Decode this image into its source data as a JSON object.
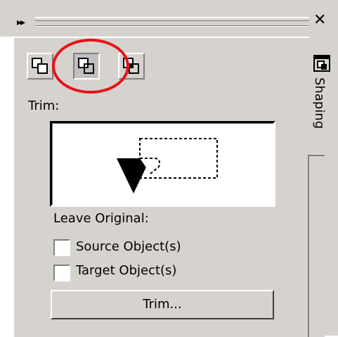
{
  "window": {
    "grip_glyph": "▸▸",
    "close_glyph": "✕"
  },
  "toolbar": {
    "buttons": [
      {
        "name": "weld",
        "state": "raised"
      },
      {
        "name": "trim",
        "state": "pressed"
      },
      {
        "name": "intersect",
        "state": "raised"
      }
    ],
    "highlight_color": "#e8101a"
  },
  "mode_label": "Trim:",
  "leave_original_label": "Leave Original:",
  "checkboxes": [
    {
      "label": "Source Object(s)",
      "checked": false
    },
    {
      "label": "Target Object(s)",
      "checked": false
    }
  ],
  "action_button": "Trim...",
  "side_tab": {
    "label": "Shaping",
    "icon": "shaping-docker-icon"
  }
}
